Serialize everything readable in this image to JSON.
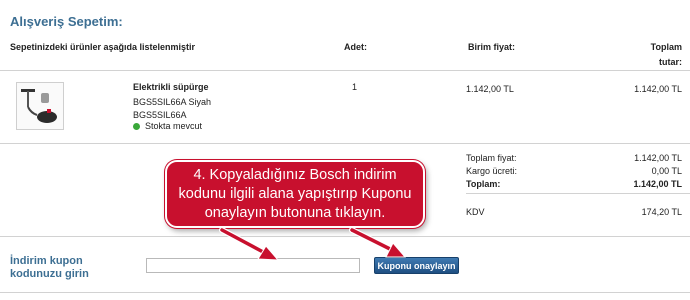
{
  "cart": {
    "title": "Alışveriş Sepetim:",
    "intro": "Sepetinizdeki ürünler aşağıda listelenmiştir",
    "columns": {
      "quantity": "Adet:",
      "unit_price": "Birim fiyat:",
      "total_line1": "Toplam",
      "total_line2": "tutar:"
    },
    "item": {
      "name": "Elektrikli süpürge",
      "desc_line1": "BGS5SIL66A Siyah",
      "desc_line2": "BGS5SIL66A",
      "stock": "Stokta mevcut",
      "quantity": "1",
      "unit_price": "1.142,00 TL",
      "total": "1.142,00 TL",
      "image_icon": "vacuum-cleaner-icon"
    },
    "summary": {
      "subtotal_label": "Toplam fiyat:",
      "subtotal_value": "1.142,00 TL",
      "shipping_label": "Kargo ücreti:",
      "shipping_value": "0,00 TL",
      "total_label": "Toplam:",
      "total_value": "1.142,00 TL",
      "vat_label": "KDV",
      "vat_value": "174,20 TL"
    }
  },
  "coupon": {
    "label_line1": "İndirim kupon",
    "label_line2": "kodunuzu girin",
    "input_value": "",
    "button_label": "Kuponu onaylayın"
  },
  "callout": {
    "text": "4. Kopyaladığınız Bosch indirim kodunu ilgili alana yapıştırıp Kuponu onaylayın butonuna tıklayın."
  },
  "colors": {
    "heading": "#3d6f93",
    "callout_bg": "#c8102e",
    "stock_dot": "#3aa83a",
    "button": "#2a5f94"
  }
}
